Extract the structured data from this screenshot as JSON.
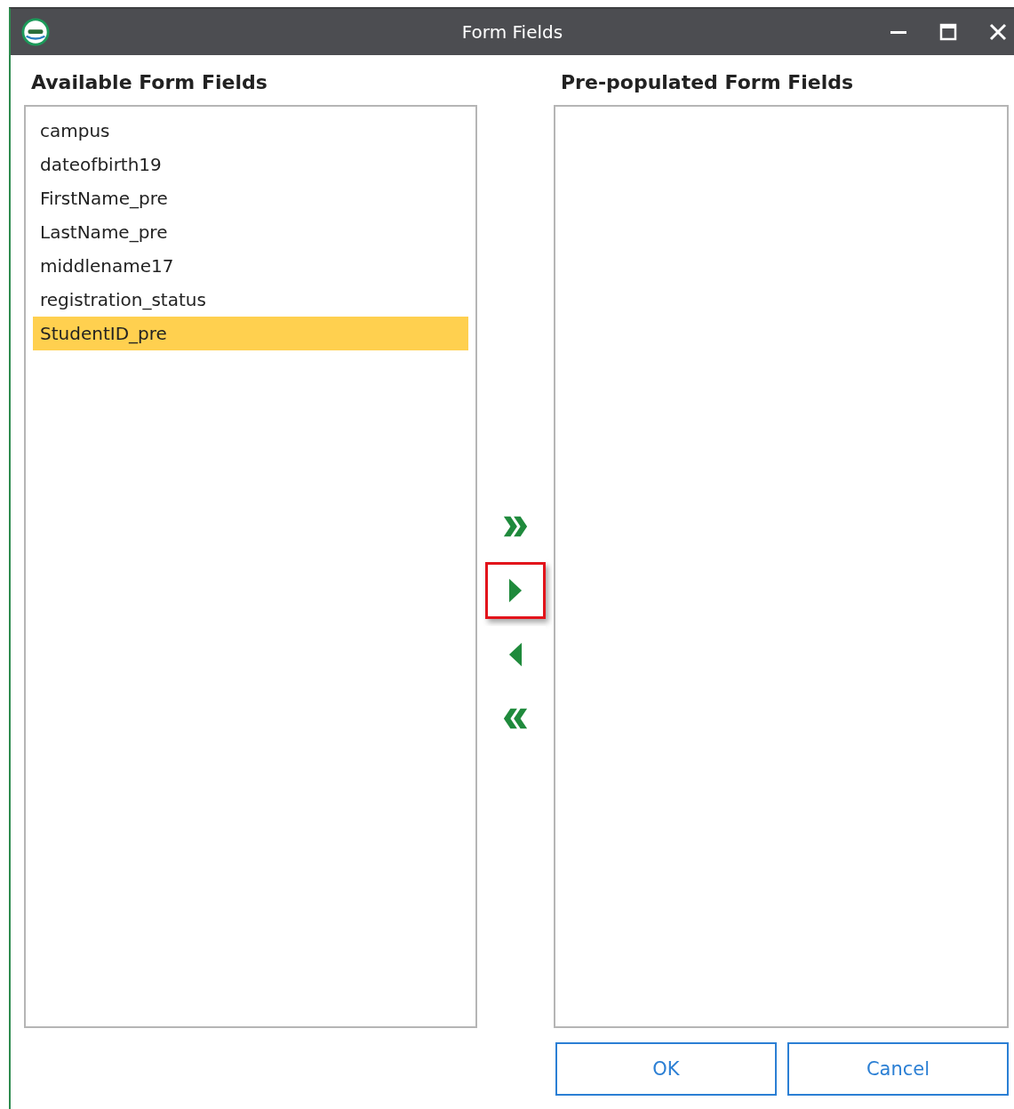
{
  "window": {
    "title": "Form Fields"
  },
  "available": {
    "heading": "Available Form Fields",
    "items": [
      {
        "label": "campus",
        "selected": false
      },
      {
        "label": "dateofbirth19",
        "selected": false
      },
      {
        "label": "FirstName_pre",
        "selected": false
      },
      {
        "label": "LastName_pre",
        "selected": false
      },
      {
        "label": "middlename17",
        "selected": false
      },
      {
        "label": "registration_status",
        "selected": false
      },
      {
        "label": "StudentID_pre",
        "selected": true
      }
    ]
  },
  "transfer_buttons": [
    {
      "kind": "add-all",
      "highlighted": false
    },
    {
      "kind": "add",
      "highlighted": true
    },
    {
      "kind": "remove",
      "highlighted": false
    },
    {
      "kind": "remove-all",
      "highlighted": false
    }
  ],
  "prepopulated": {
    "heading": "Pre-populated Form Fields"
  },
  "buttons": [
    "OK",
    "Cancel"
  ]
}
